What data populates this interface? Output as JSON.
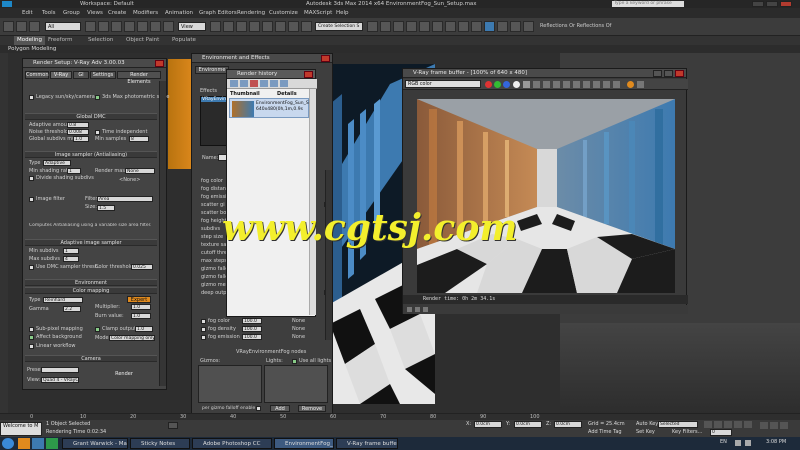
{
  "window": {
    "workspace_label": "Workspace: Default",
    "title": "Autodesk 3ds Max 2014 x64    EnvironmentFog_Sun_Setup.max",
    "search_placeholder": "Type a keyword or phrase"
  },
  "menu": [
    "Edit",
    "Tools",
    "Group",
    "Views",
    "Create",
    "Modifiers",
    "Animation",
    "Graph Editors",
    "Rendering",
    "Customize",
    "MAXScript",
    "Help"
  ],
  "toolbar": {
    "selection_filter": "All",
    "view_label": "View",
    "named_selection": "Create Selection S",
    "reflections_label": "Reflections Or Reflections Of"
  },
  "ribbon": {
    "tabs": [
      "Modeling",
      "Freeform",
      "Selection",
      "Object Paint",
      "Populate"
    ],
    "sub": "Polygon Modeling"
  },
  "render_setup": {
    "title": "Render Setup: V-Ray Adv 3.00.03",
    "tabs": [
      "Common",
      "V-Ray",
      "GI",
      "Settings",
      "Render Elements"
    ],
    "legacy_label": "Legacy sun/sky/camera",
    "photometric_label": "3ds Max photometric scale",
    "global_dmc": "Global DMC",
    "adaptive_amount_label": "Adaptive amount",
    "adaptive_amount": "0.8",
    "noise_threshold_label": "Noise threshold",
    "noise_threshold": "0.008",
    "global_subdivs_label": "Global subdivs mult",
    "global_subdivs": "1.0",
    "time_independent": "Time independent",
    "min_samples_label": "Min samples",
    "min_samples": "8",
    "image_sampler": "Image sampler (Antialiasing)",
    "type_label": "Type",
    "type_value": "Adaptive",
    "min_shading_label": "Min shading rate",
    "min_shading": "1",
    "render_mask_label": "Render mask",
    "render_mask": "None",
    "divide_shading": "Divide shading subdivs",
    "none_label": "<None>",
    "image_filter_label": "Image filter",
    "filter_label": "Filter",
    "filter_value": "Area",
    "size_label": "Size:",
    "size_value": "1.5",
    "filter_desc": "Computes Antialiasing using a variable size area filter.",
    "adaptive_sampler": "Adaptive image sampler",
    "min_subdivs_label": "Min subdivs",
    "min_subdivs": "1",
    "max_subdivs_label": "Max subdivs",
    "max_subdivs": "4",
    "use_dmc_label": "Use DMC sampler thresh.",
    "color_threshold_label": "Color threshold",
    "color_threshold": "0.025",
    "environment": "Environment",
    "color_mapping": "Color mapping",
    "cm_type_label": "Type",
    "cm_type": "Reinhard",
    "expert_label": "Expert",
    "gamma_label": "Gamma",
    "gamma": "2.2",
    "multiplier_label": "Multiplier:",
    "multiplier": "1.0",
    "burn_label": "Burn value:",
    "burn": "1.0",
    "subpixel_label": "Sub-pixel mapping",
    "clamp_label": "Clamp output",
    "clamp": "1.0",
    "affect_bg_label": "Affect background",
    "mode_label": "Mode",
    "mode_value": "Color mapping only (",
    "linear_label": "Linear workflow",
    "camera": "Camera",
    "preset_label": "Preset:",
    "view_label": "View:",
    "view_value": "Quad 4 - VRayC",
    "render_label": "Render"
  },
  "env_effects": {
    "title": "Environment and Effects",
    "tab": "Environme",
    "effects_label": "Effects",
    "list_item": "VRayEnvironm",
    "name_label": "Name:",
    "params": [
      "fog color",
      "fog distance",
      "fog emission",
      "scatter gi",
      "scatter bounce",
      "fog height",
      "subdivs",
      "step size",
      "texture samples",
      "cutoff thresh",
      "max steps",
      "gizmo falloff",
      "gizmo falloff m",
      "gizmo merge m",
      "deep output"
    ],
    "fog_color_label": "fog color",
    "fog_density_label": "fog density",
    "fog_emission_label": "fog emission",
    "val_100": "100.0",
    "none": "None",
    "nodes_title": "VRayEnvironmentFog nodes",
    "gizmos_label": "Gizmos:",
    "lights_label": "Lights:",
    "use_all_lights": "Use all lights",
    "per_gizmo": "per gizmo falloff enable",
    "add_label": "Add",
    "remove_label": "Remove"
  },
  "render_history": {
    "title": "Render history",
    "col_thumbnail": "Thumbnail",
    "col_details": "Details",
    "entry_name": "EnvironmentFog_Sun_S",
    "entry_info": "640x480(0h,1m,0.9s"
  },
  "vfb": {
    "title": "V-Ray frame buffer - [100% of 640 x 480]",
    "channel": "RGB color",
    "render_time": "Render time: 0h 2m 34.1s"
  },
  "timeline": {
    "ticks": [
      "0",
      "10",
      "20",
      "30",
      "40",
      "50",
      "60",
      "70",
      "80",
      "90",
      "100"
    ]
  },
  "statusbar": {
    "listener": "Welcome to M",
    "object_selected": "1 Object Selected",
    "rendering_time": "Rendering Time 0:02:34",
    "x_label": "X:",
    "x_value": "0.0cm",
    "y_label": "Y:",
    "y_value": "0.0cm",
    "z_label": "Z:",
    "z_value": "0.0cm",
    "grid": "Grid = 25.4cm",
    "add_time_tag": "Add Time Tag",
    "auto_key": "Auto Key",
    "selected": "Selected",
    "set_key": "Set Key",
    "key_filters": "Key Filters...",
    "frame": "0"
  },
  "taskbar": {
    "items": [
      "Grant Warwick - Mas...",
      "Sticky Notes",
      "Adobe Photoshop CC",
      "EnvironmentFog_Su...",
      "V-Ray frame buffer -..."
    ],
    "lang": "EN",
    "clock": "3:08 PM"
  },
  "watermark": "www.cgtsj.com",
  "colors": {
    "accent_orange": "#e08a1e",
    "watermark_yellow": "#f3ef2d",
    "taskbar": "#1d2a3a",
    "render_blue": "#3d7ab0"
  }
}
